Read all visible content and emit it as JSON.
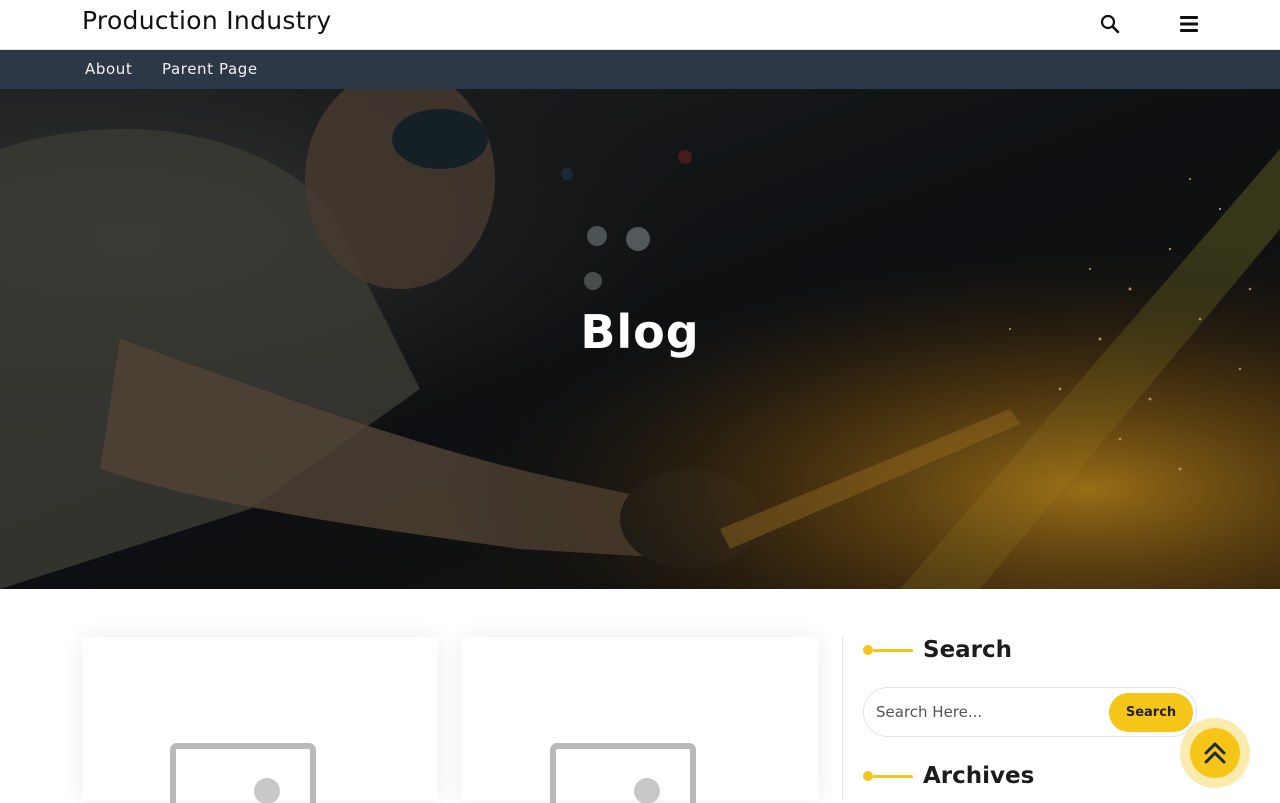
{
  "header": {
    "site_title": "Production Industry",
    "icons": [
      "search-icon",
      "hamburger-menu-icon"
    ]
  },
  "nav": {
    "items": [
      {
        "label": "About"
      },
      {
        "label": "Parent Page"
      }
    ]
  },
  "hero": {
    "title": "Blog"
  },
  "posts": [
    {
      "thumbnail": "placeholder-image-icon"
    },
    {
      "thumbnail": "placeholder-image-icon"
    }
  ],
  "sidebar": {
    "search": {
      "heading": "Search",
      "placeholder": "Search Here...",
      "button_label": "Search"
    },
    "archives": {
      "heading": "Archives"
    }
  },
  "back_to_top": {
    "icon": "double-chevron-up-icon"
  },
  "colors": {
    "accent": "#f5c518",
    "nav_bg": "#2d3846",
    "text": "#111111"
  }
}
